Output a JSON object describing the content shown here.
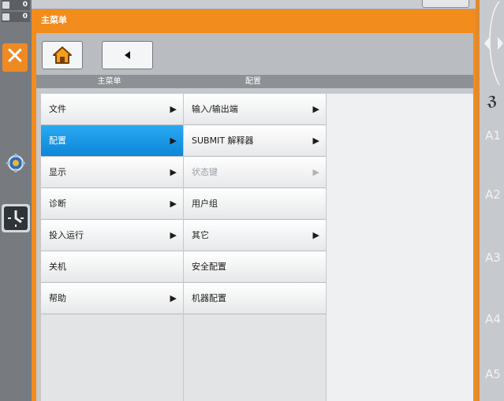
{
  "status_counters": [
    {
      "icon": "input-counter-icon",
      "value": "0"
    },
    {
      "icon": "output-counter-icon",
      "value": "0"
    }
  ],
  "window": {
    "title": "主菜单"
  },
  "toolbar": {
    "home_icon": "home-icon",
    "back_icon": "back-arrow-icon"
  },
  "columns": {
    "left_header": "主菜单",
    "right_header": "配置"
  },
  "main_menu": [
    {
      "label": "文件",
      "arrow": "▶",
      "selected": false
    },
    {
      "label": "配置",
      "arrow": "▶",
      "selected": true
    },
    {
      "label": "显示",
      "arrow": "▶",
      "selected": false
    },
    {
      "label": "诊断",
      "arrow": "▶",
      "selected": false
    },
    {
      "label": "投入运行",
      "arrow": "▶",
      "selected": false
    },
    {
      "label": "关机",
      "arrow": "",
      "selected": false
    },
    {
      "label": "帮助",
      "arrow": "▶",
      "selected": false
    }
  ],
  "config_menu": [
    {
      "label": "输入/输出端",
      "arrow": "▶",
      "disabled": false
    },
    {
      "label": "SUBMIT 解释器",
      "arrow": "▶",
      "disabled": false
    },
    {
      "label": "状态键",
      "arrow": "▶",
      "disabled": true
    },
    {
      "label": "用户组",
      "arrow": "",
      "disabled": false
    },
    {
      "label": "其它",
      "arrow": "▶",
      "disabled": false
    },
    {
      "label": "安全配置",
      "arrow": "",
      "disabled": false
    },
    {
      "label": "机器配置",
      "arrow": "",
      "disabled": false
    }
  ],
  "axes": [
    "A1",
    "A2",
    "A3",
    "A4",
    "A5"
  ],
  "colors": {
    "accent_orange": "#f28c1d",
    "selected_blue": "#1697e6"
  }
}
